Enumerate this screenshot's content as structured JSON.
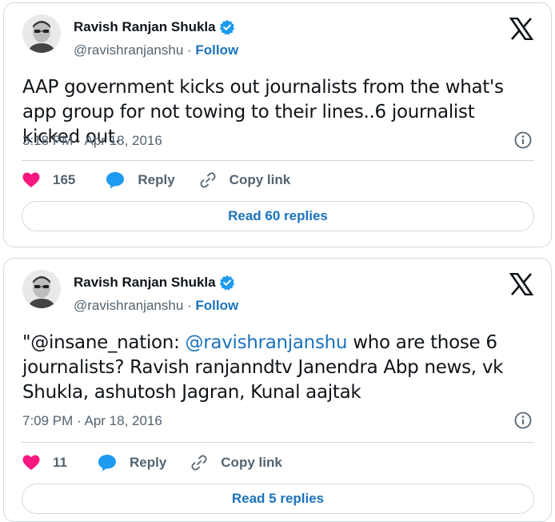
{
  "brand_color": "#1d9bf0",
  "tweets": [
    {
      "author": {
        "name": "Ravish Ranjan Shukla",
        "handle": "@ravishranjanshu",
        "separator": "·",
        "follow_label": "Follow",
        "verified": true,
        "avatar_icon": "avatar-photo"
      },
      "platform_icon": "x-logo-icon",
      "text": "AAP government kicks out journalists from the what's app group for not towing to their lines..6 journalist kicked out.",
      "timestamp": "3:18 PM · Apr 18, 2016",
      "likes": "165",
      "reply_label": "Reply",
      "copy_label": "Copy link",
      "read_replies_label": "Read 60 replies"
    },
    {
      "author": {
        "name": "Ravish Ranjan Shukla",
        "handle": "@ravishranjanshu",
        "separator": "·",
        "follow_label": "Follow",
        "verified": true,
        "avatar_icon": "avatar-photo"
      },
      "platform_icon": "x-logo-icon",
      "text_parts": [
        "\"@insane_nation: ",
        "@ravishranjanshu",
        " who are those 6 journalists? Ravish ranjanndtv Janendra Abp news, vk Shukla, ashutosh Jagran, Kunal aajtak"
      ],
      "timestamp": "7:09 PM · Apr 18, 2016",
      "likes": "11",
      "reply_label": "Reply",
      "copy_label": "Copy link",
      "read_replies_label": "Read 5 replies"
    }
  ]
}
